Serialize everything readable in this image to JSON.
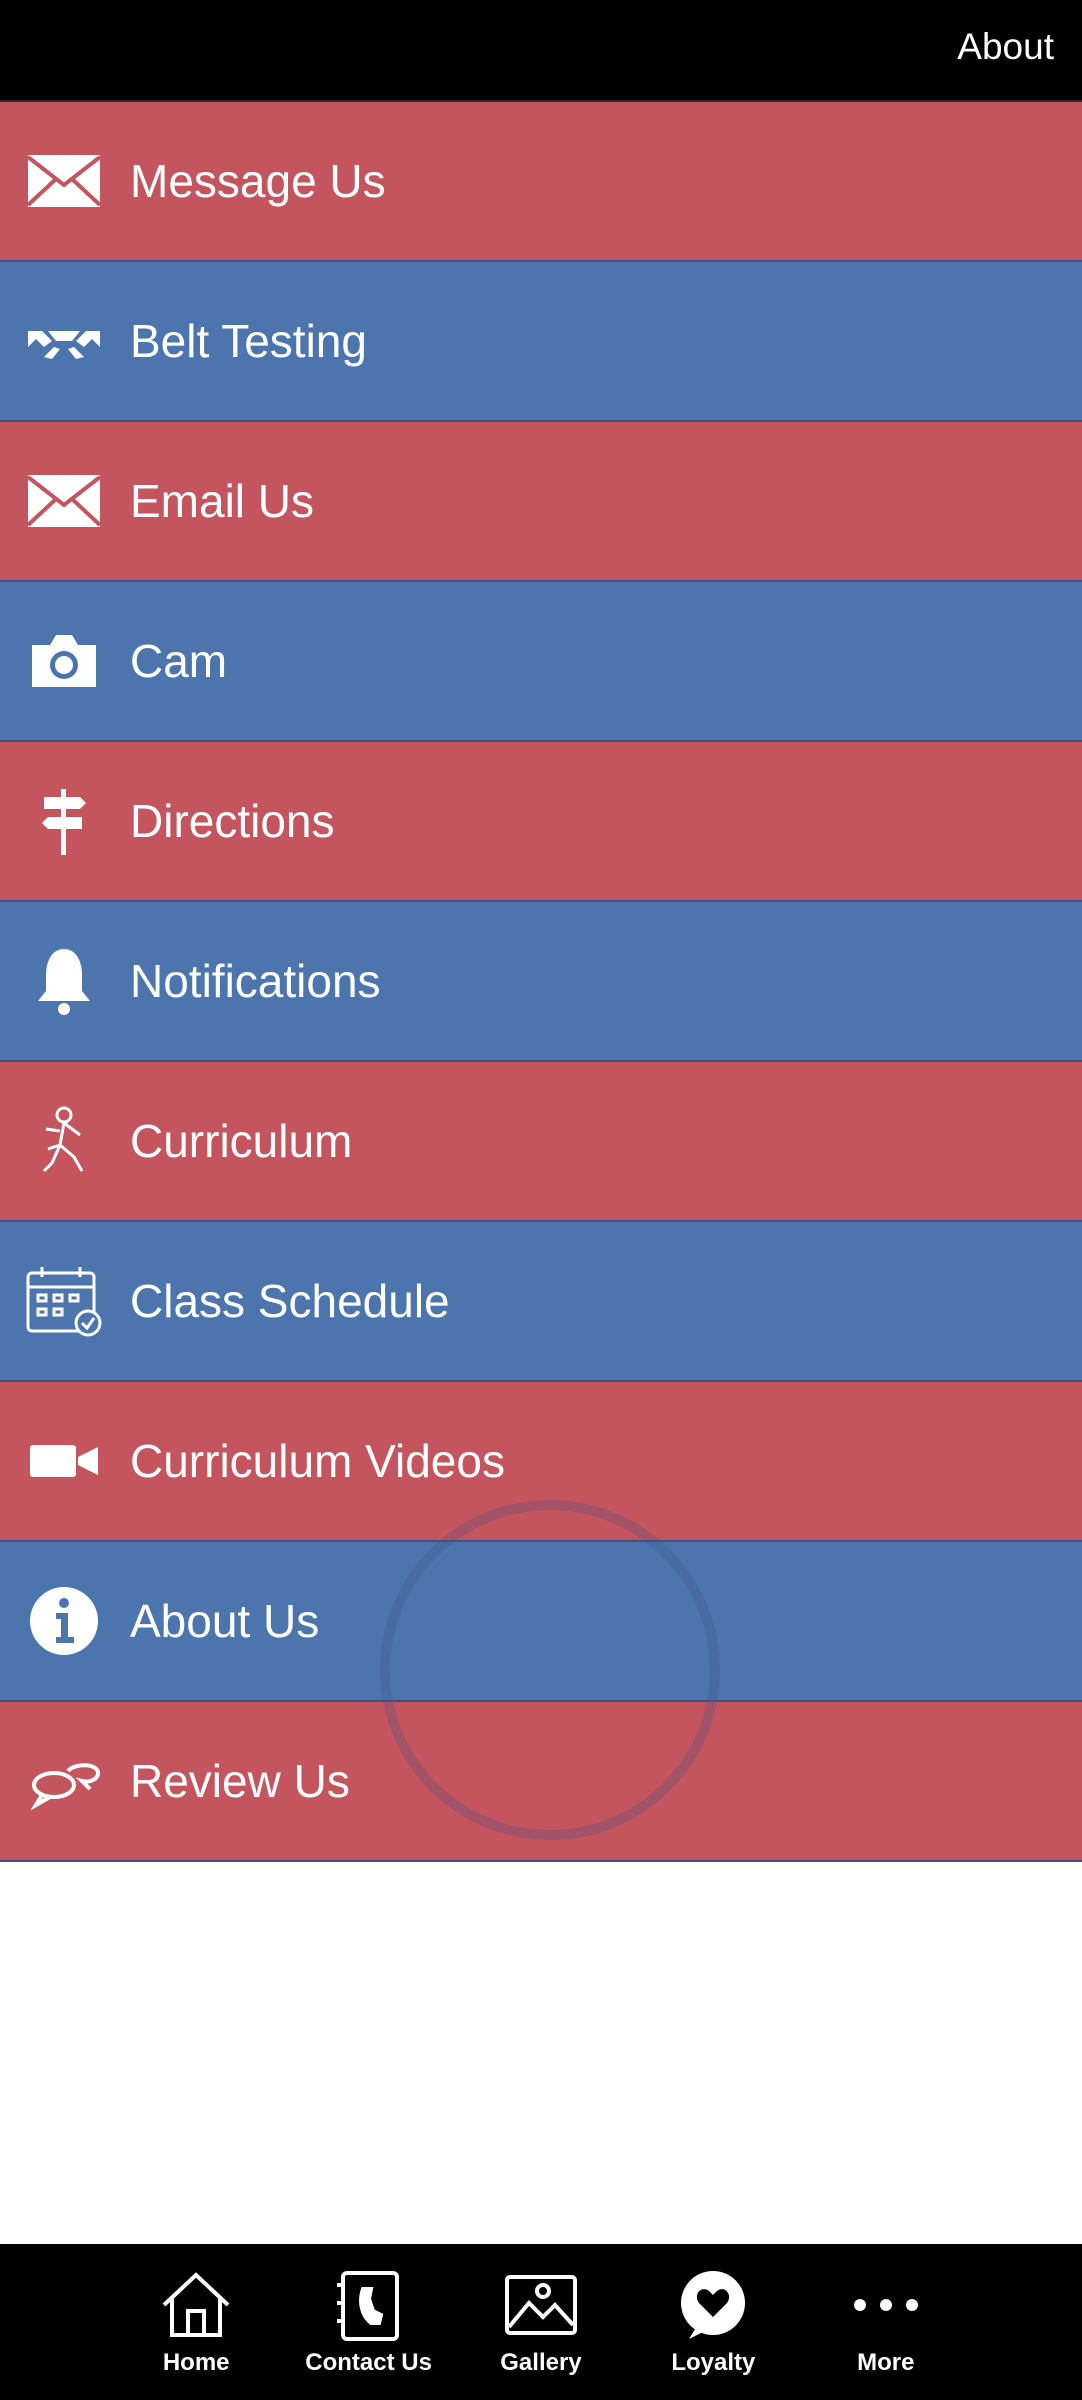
{
  "header": {
    "title": "About"
  },
  "menu": [
    {
      "label": "Message Us",
      "icon": "envelope-icon",
      "color": "#c4545e"
    },
    {
      "label": "Belt Testing",
      "icon": "belt-icon",
      "color": "#4b75ac"
    },
    {
      "label": "Email Us",
      "icon": "envelope-icon",
      "color": "#c4545e"
    },
    {
      "label": "Cam",
      "icon": "camera-icon",
      "color": "#4b75ac"
    },
    {
      "label": "Directions",
      "icon": "signpost-icon",
      "color": "#c4545e"
    },
    {
      "label": "Notifications",
      "icon": "bell-icon",
      "color": "#4b75ac"
    },
    {
      "label": "Curriculum",
      "icon": "martial-artist-icon",
      "color": "#c4545e"
    },
    {
      "label": "Class Schedule",
      "icon": "calendar-check-icon",
      "color": "#4b75ac"
    },
    {
      "label": "Curriculum Videos",
      "icon": "video-camera-icon",
      "color": "#c4545e"
    },
    {
      "label": "About Us",
      "icon": "info-icon",
      "color": "#4b75ac"
    },
    {
      "label": "Review Us",
      "icon": "chat-bubbles-icon",
      "color": "#c4545e"
    }
  ],
  "tabbar": [
    {
      "label": "Home",
      "icon": "home-icon"
    },
    {
      "label": "Contact Us",
      "icon": "phone-book-icon"
    },
    {
      "label": "Gallery",
      "icon": "image-icon"
    },
    {
      "label": "Loyalty",
      "icon": "heart-bubble-icon"
    },
    {
      "label": "More",
      "icon": "more-dots-icon"
    }
  ]
}
